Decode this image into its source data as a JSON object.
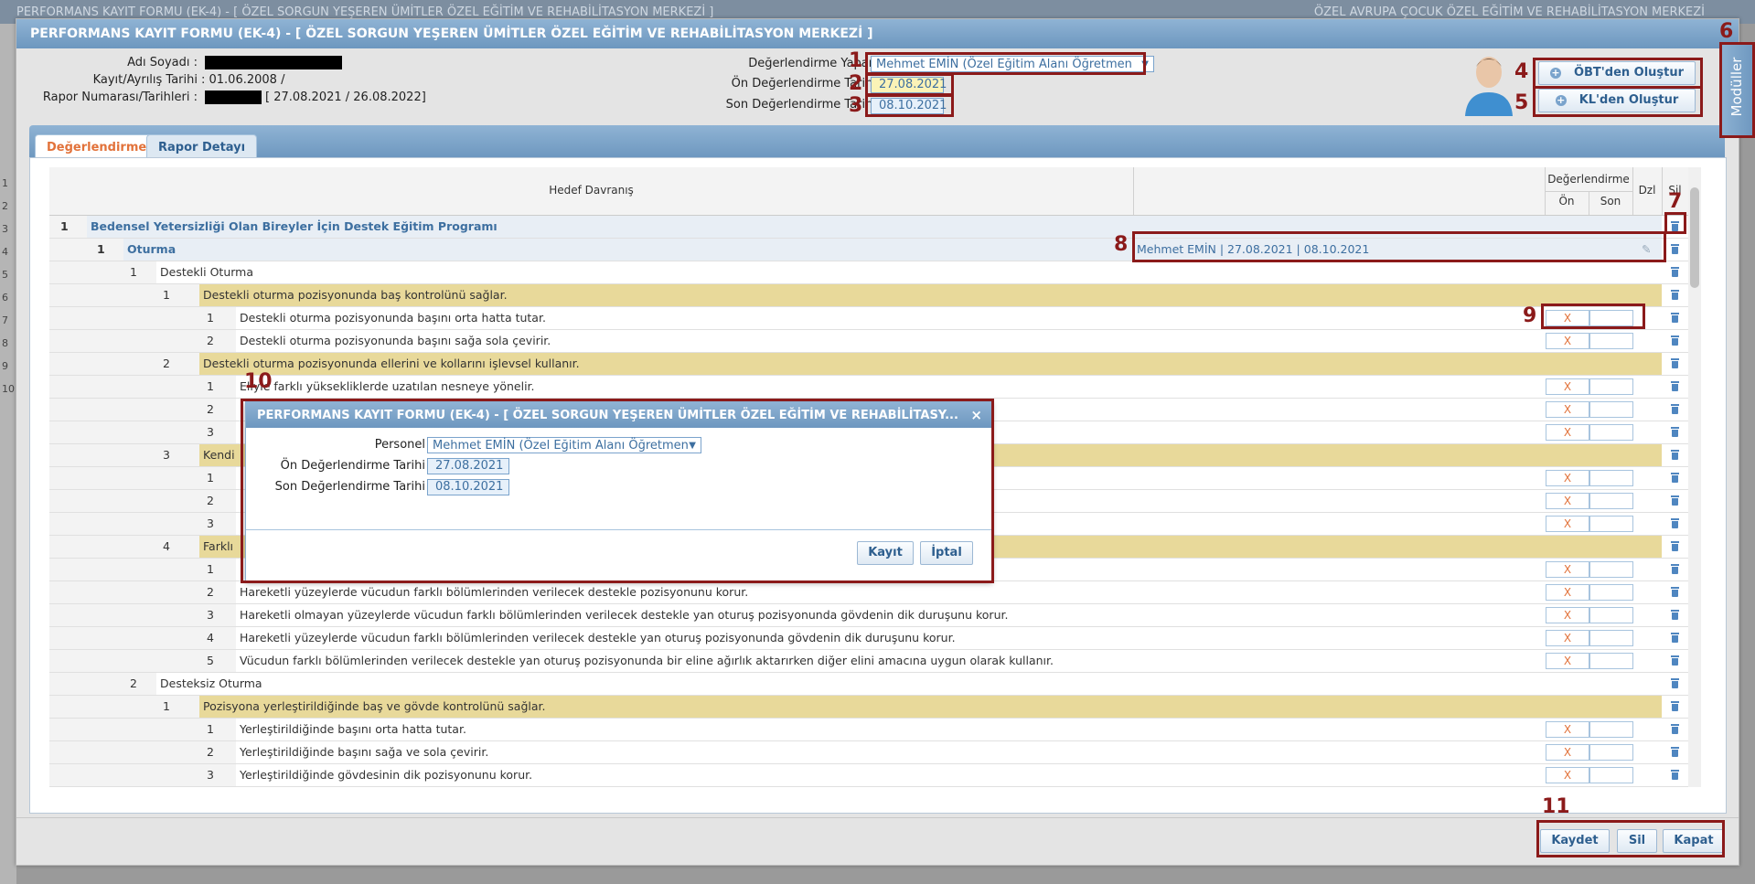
{
  "background": {
    "title": "PERFORMANS KAYIT FORMU (EK-4) - [ ÖZEL SORGUN YEŞEREN ÜMİTLER ÖZEL EĞİTİM VE REHABİLİTASYON MERKEZİ ]",
    "right_title": "ÖZEL AVRUPA ÇOCUK ÖZEL EĞİTİM VE REHABİLİTASYON MERKEZİ",
    "row_numbers": [
      "1",
      "2",
      "3",
      "4",
      "5",
      "6",
      "7",
      "8",
      "9",
      "10"
    ]
  },
  "window": {
    "title": "PERFORMANS KAYIT FORMU (EK-4) - [ ÖZEL SORGUN YEŞEREN ÜMİTLER ÖZEL EĞİTİM VE REHABİLİTASYON MERKEZİ ]"
  },
  "student": {
    "name_label": "Adı Soyadı",
    "dates_label": "Kayıt/Ayrılış Tarihi",
    "dates_value": ": 01.06.2008 /",
    "report_label": "Rapor Numarası/Tarihleri",
    "report_value": "[ 27.08.2021 / 26.08.2022]"
  },
  "evaluation": {
    "evaluator_label": "Değerlendirme Yapan",
    "evaluator_value": "Mehmet EMİN (Özel Eğitim Alanı Öğretmen",
    "pre_label": "Ön Değerlendirme Tarihi",
    "pre_value": "27.08.2021",
    "post_label": "Son Değerlendirme Tarihi",
    "post_value": "08.10.2021"
  },
  "buttons": {
    "obt": "ÖBT'den Oluştur",
    "kl": "KL'den Oluştur",
    "modules": "Modüller",
    "save": "Kaydet",
    "delete": "Sil",
    "close": "Kapat"
  },
  "tabs": [
    "Değerlendirme",
    "Rapor Detayı"
  ],
  "grid": {
    "headers": {
      "target": "Hedef Davranış",
      "evaluation": "Değerlendirme",
      "pre": "Ön",
      "post": "Son",
      "edit": "Dzl",
      "delete": "Sil"
    },
    "rows": [
      {
        "level": 0,
        "num": "1",
        "text": "Bedensel Yetersizliği Olan Bireyler İçin Destek Eğitim Programı",
        "style": "program",
        "x": "",
        "trash": true
      },
      {
        "level": 1,
        "num": "1",
        "text": "Oturma",
        "style": "module",
        "info": "Mehmet EMİN | 27.08.2021 | 08.10.2021",
        "x": "",
        "trash": true
      },
      {
        "level": 2,
        "num": "1",
        "text": "Destekli Oturma",
        "style": "unit",
        "x": "",
        "trash": true
      },
      {
        "level": 3,
        "num": "1",
        "text": "Destekli oturma pozisyonunda baş kontrolünü sağlar.",
        "style": "goal",
        "x": "",
        "trash": true
      },
      {
        "level": 4,
        "num": "1",
        "text": "Destekli oturma pozisyonunda başını orta hatta tutar.",
        "style": "item",
        "x": "X",
        "trash": true
      },
      {
        "level": 4,
        "num": "2",
        "text": "Destekli oturma pozisyonunda başını sağa sola çevirir.",
        "style": "item",
        "x": "X",
        "trash": true
      },
      {
        "level": 3,
        "num": "2",
        "text": "Destekli oturma pozisyonunda ellerini ve kollarını işlevsel kullanır.",
        "style": "goal",
        "x": "",
        "trash": true
      },
      {
        "level": 4,
        "num": "1",
        "text": "Eliyle farklı yüksekliklerde uzatılan nesneye yönelir.",
        "style": "item",
        "x": "X",
        "trash": true
      },
      {
        "level": 4,
        "num": "2",
        "text": "",
        "style": "item",
        "x": "X",
        "trash": true
      },
      {
        "level": 4,
        "num": "3",
        "text": "",
        "style": "item",
        "x": "X",
        "trash": true
      },
      {
        "level": 3,
        "num": "3",
        "text": "Kendi",
        "style": "goal",
        "x": "",
        "trash": true
      },
      {
        "level": 4,
        "num": "1",
        "text": "",
        "style": "item",
        "x": "X",
        "trash": true
      },
      {
        "level": 4,
        "num": "2",
        "text": "",
        "style": "item",
        "x": "X",
        "trash": true
      },
      {
        "level": 4,
        "num": "3",
        "text": "",
        "style": "item",
        "x": "X",
        "trash": true
      },
      {
        "level": 3,
        "num": "4",
        "text": "Farklı",
        "style": "goal",
        "x": "",
        "trash": true
      },
      {
        "level": 4,
        "num": "1",
        "text": "",
        "style": "item",
        "x": "X",
        "trash": true
      },
      {
        "level": 4,
        "num": "2",
        "text": "Hareketli yüzeylerde vücudun farklı bölümlerinden verilecek destekle pozisyonunu korur.",
        "style": "item",
        "x": "X",
        "trash": true
      },
      {
        "level": 4,
        "num": "3",
        "text": "Hareketli olmayan yüzeylerde vücudun farklı bölümlerinden verilecek destekle yan oturuş pozisyonunda gövdenin dik duruşunu korur.",
        "style": "item",
        "x": "X",
        "trash": true
      },
      {
        "level": 4,
        "num": "4",
        "text": "Hareketli yüzeylerde vücudun farklı bölümlerinden verilecek destekle yan oturuş pozisyonunda gövdenin dik duruşunu korur.",
        "style": "item",
        "x": "X",
        "trash": true
      },
      {
        "level": 4,
        "num": "5",
        "text": "Vücudun farklı bölümlerinden verilecek destekle yan oturuş pozisyonunda bir eline ağırlık aktarırken diğer elini amacına uygun olarak kullanır.",
        "style": "item",
        "x": "X",
        "trash": true
      },
      {
        "level": 2,
        "num": "2",
        "text": "Desteksiz Oturma",
        "style": "unit",
        "x": "",
        "trash": true
      },
      {
        "level": 3,
        "num": "1",
        "text": "Pozisyona yerleştirildiğinde baş ve gövde kontrolünü sağlar.",
        "style": "goal",
        "x": "",
        "trash": true
      },
      {
        "level": 4,
        "num": "1",
        "text": "Yerleştirildiğinde başını orta hatta tutar.",
        "style": "item",
        "x": "X",
        "trash": true
      },
      {
        "level": 4,
        "num": "2",
        "text": "Yerleştirildiğinde başını sağa ve sola çevirir.",
        "style": "item",
        "x": "X",
        "trash": true
      },
      {
        "level": 4,
        "num": "3",
        "text": "Yerleştirildiğinde gövdesinin dik pozisyonunu korur.",
        "style": "item",
        "x": "X",
        "trash": true
      }
    ]
  },
  "dialog": {
    "title": "PERFORMANS KAYIT FORMU (EK-4) - [ ÖZEL SORGUN YEŞEREN ÜMİTLER ÖZEL EĞİTİM VE REHABİLİTASY...",
    "close": "×",
    "personnel_label": "Personel",
    "personnel_value": "Mehmet EMİN (Özel Eğitim Alanı Öğretmen",
    "pre_label": "Ön Değerlendirme Tarihi",
    "pre_value": "27.08.2021",
    "post_label": "Son Değerlendirme Tarihi",
    "post_value": "08.10.2021",
    "save": "Kayıt",
    "cancel": "İptal"
  },
  "annotations": [
    "1",
    "2",
    "3",
    "4",
    "5",
    "6",
    "7",
    "8",
    "9",
    "10",
    "11"
  ],
  "colors": {
    "accent_red": "#8b1a1a",
    "header_blue": "#6d97bf",
    "goal_row": "#e8d99a",
    "active_tab": "#e2723a"
  }
}
